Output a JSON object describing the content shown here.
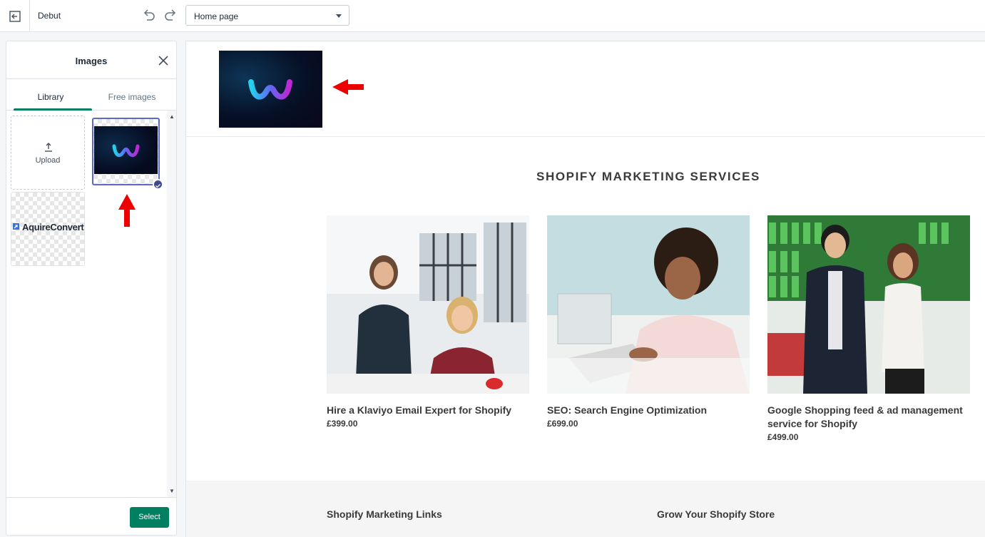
{
  "topbar": {
    "theme_name": "Debut",
    "page_select_value": "Home page"
  },
  "panel": {
    "title": "Images",
    "tabs": [
      {
        "label": "Library",
        "active": true
      },
      {
        "label": "Free images",
        "active": false
      }
    ],
    "upload_label": "Upload",
    "library_items": [
      {
        "icon": "logo-w-icon",
        "selected": true
      },
      {
        "text": "AquireConvert",
        "selected": false
      }
    ],
    "select_label": "Select"
  },
  "preview": {
    "section_title": "SHOPIFY MARKETING SERVICES",
    "products": [
      {
        "title": "Hire a Klaviyo Email Expert for Shopify",
        "price": "£399.00"
      },
      {
        "title": "SEO: Search Engine Optimization",
        "price": "£699.00"
      },
      {
        "title": "Google Shopping feed & ad management service for Shopify",
        "price": "£499.00"
      }
    ],
    "footer_columns": [
      "Shopify Marketing Links",
      "Grow Your Shopify Store"
    ]
  },
  "colors": {
    "accent": "#008060",
    "selected_border": "#5c6ac4",
    "annotation_arrow": "#ee0000"
  }
}
